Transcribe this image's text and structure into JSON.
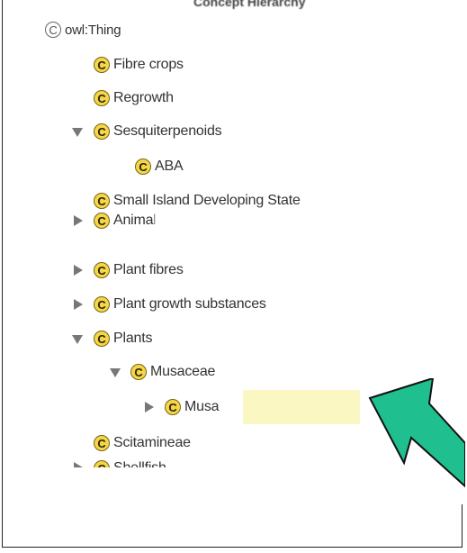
{
  "panel": {
    "header": "Concept Hierarchy"
  },
  "tree": {
    "root": {
      "label": "owl:Thing",
      "badge": "C"
    },
    "items": [
      {
        "label": "Fibre crops",
        "badge": "C"
      },
      {
        "label": "Regrowth",
        "badge": "C"
      },
      {
        "label": "Sesquiterpenoids",
        "badge": "C",
        "expanded": true
      },
      {
        "label": "ABA",
        "badge": "C"
      },
      {
        "label": "Small Island Developing State",
        "badge": "C"
      },
      {
        "label": "Animal",
        "badge": "C",
        "expanded": false
      },
      {
        "label": "Plant fibres",
        "badge": "C",
        "expanded": false
      },
      {
        "label": "Plant growth substances",
        "badge": "C",
        "expanded": false
      },
      {
        "label": "Plants",
        "badge": "C",
        "expanded": true
      },
      {
        "label": "Musaceae",
        "badge": "C",
        "expanded": true
      },
      {
        "label": "Musa",
        "badge": "C",
        "expanded": false,
        "selected": true
      },
      {
        "label": "Scitamineae",
        "badge": "C"
      },
      {
        "label": "Shellfish",
        "badge": "C",
        "expanded": false
      }
    ]
  },
  "colors": {
    "pointer_arrow": "#1fbf8f",
    "selection": "#fbf7c2",
    "badge": "#f3d64a"
  },
  "icons": {
    "pointer": "arrow-pointer-icon"
  }
}
